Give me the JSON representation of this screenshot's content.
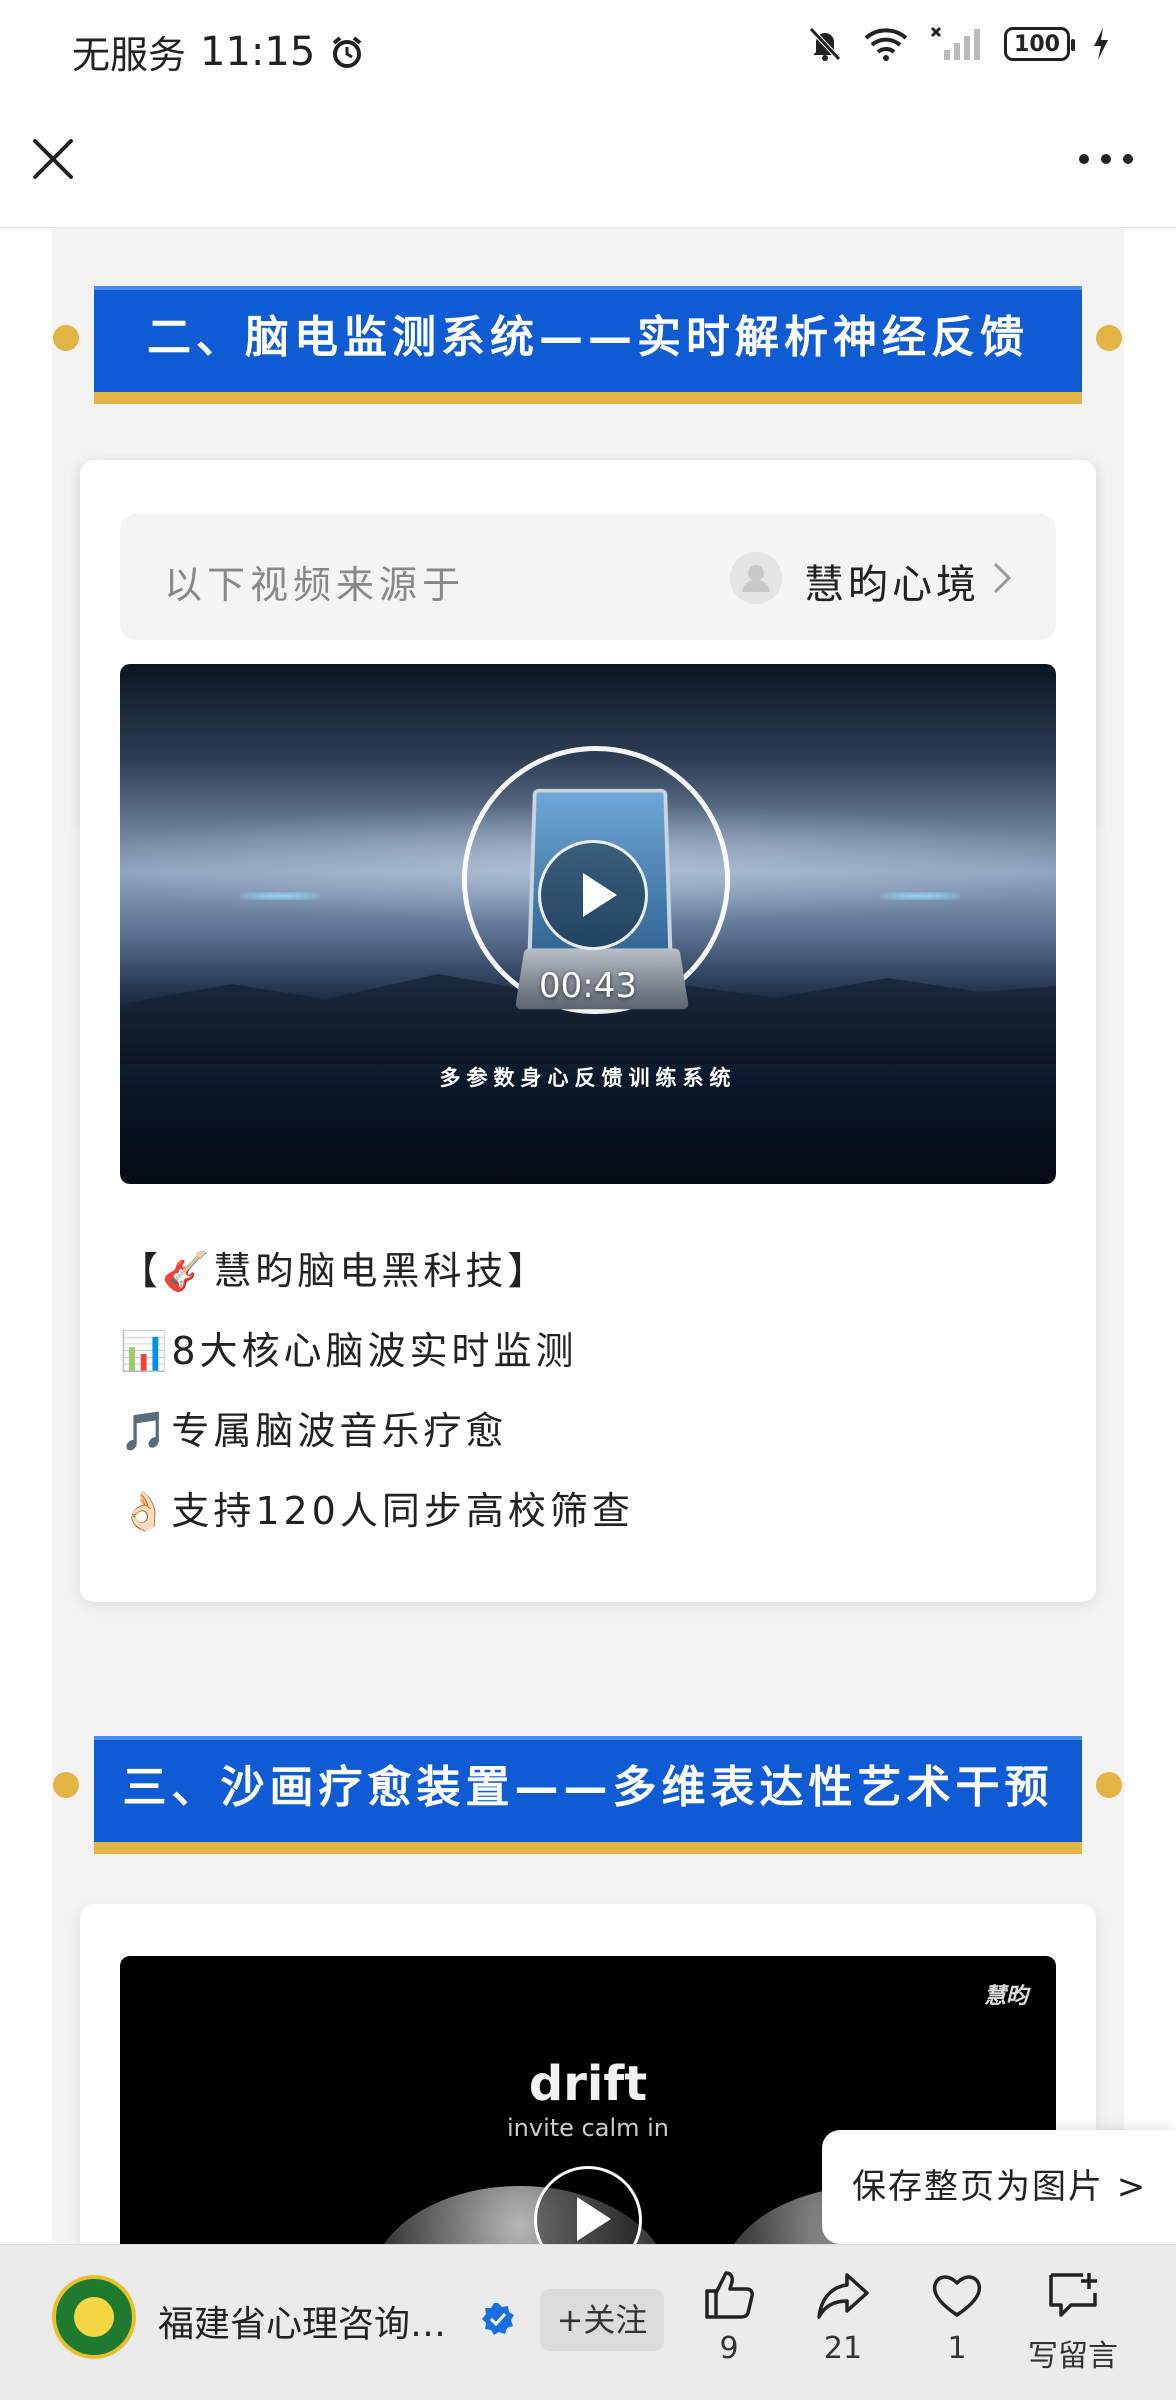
{
  "status_bar": {
    "carrier": "无服务",
    "time": "11:15",
    "battery": "100"
  },
  "nav": {
    "close_icon": "close-icon",
    "more_icon": "more-icon"
  },
  "section2": {
    "title": "二、脑电监测系统——实时解析神经反馈",
    "source_label": "以下视频来源于",
    "source_name": "慧昀心境",
    "video": {
      "duration": "00:43",
      "caption": "多参数身心反馈训练系统"
    },
    "features": [
      "【🎸慧昀脑电黑科技】",
      "📊8大核心脑波实时监测",
      "🎵专属脑波音乐疗愈",
      "👌🏻支持120人同步高校筛查"
    ]
  },
  "section3": {
    "title": "三、沙画疗愈装置——多维表达性艺术干预",
    "video": {
      "logo": "慧昀",
      "headline": "drift",
      "subline": "invite calm in"
    }
  },
  "save_page": "保存整页为图片 >",
  "bottom_bar": {
    "account_name": "福建省心理咨询…",
    "follow": "+关注",
    "actions": [
      {
        "icon": "thumbs-up-icon",
        "count": "9"
      },
      {
        "icon": "share-icon",
        "count": "21"
      },
      {
        "icon": "heart-icon",
        "count": "1"
      },
      {
        "icon": "comment-icon",
        "count": "写留言"
      }
    ]
  },
  "colors": {
    "title_blue": "#0f5bd3",
    "gold": "#e2b443",
    "verified_blue": "#1a6fe0"
  }
}
